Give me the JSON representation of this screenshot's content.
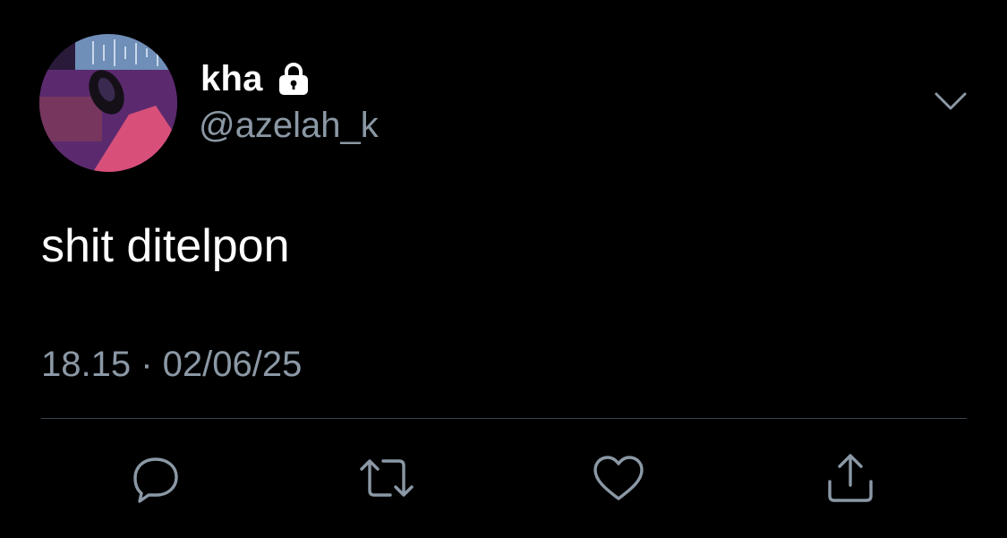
{
  "tweet": {
    "display_name": "kha",
    "handle": "@azelah_k",
    "text": "shit ditelpon",
    "timestamp": "18.15 · 02/06/25",
    "protected": true
  },
  "icons": {
    "lock": "lock-icon",
    "more": "chevron-down-icon",
    "reply": "reply-icon",
    "retweet": "retweet-icon",
    "like": "heart-icon",
    "share": "share-icon"
  },
  "colors": {
    "background": "#000000",
    "text_primary": "#ffffff",
    "text_secondary": "#8b98a5",
    "divider": "#38444d",
    "icon": "#8b98a5"
  }
}
